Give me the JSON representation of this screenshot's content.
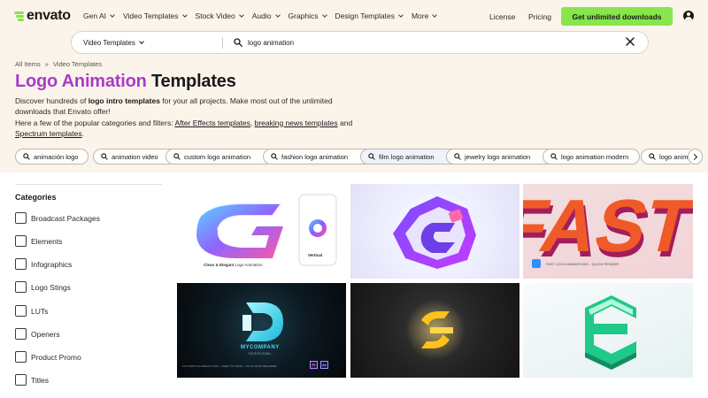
{
  "brand": {
    "name": "envato"
  },
  "nav": {
    "items": [
      {
        "label": "Gen AI"
      },
      {
        "label": "Video Templates"
      },
      {
        "label": "Stock Video"
      },
      {
        "label": "Audio"
      },
      {
        "label": "Graphics"
      },
      {
        "label": "Design Templates"
      },
      {
        "label": "More"
      }
    ],
    "license": "License",
    "pricing": "Pricing",
    "cta": "Get unlimited downloads"
  },
  "search": {
    "scope": "Video Templates",
    "query": "logo animation"
  },
  "breadcrumb": {
    "home": "All Items",
    "separator": "»",
    "current": "Video Templates"
  },
  "page": {
    "title_accent": "Logo Animation",
    "title_rest": " Templates",
    "desc": {
      "p1a": "Discover hundreds of ",
      "p1b": "logo intro templates",
      "p1c": " for your all projects. Make most out of the unlimited downloads that Envato offer!",
      "p2a": "Here a few of the popular categories and filters: ",
      "link1": "After Effects templates",
      "p2b": ", ",
      "link2": "breaking news templates",
      "p2c": " and ",
      "link3": "Spectrum templates",
      "p2d": "."
    }
  },
  "chips": [
    {
      "label": "animación logo"
    },
    {
      "label": "animation video"
    },
    {
      "label": "custom logo animation"
    },
    {
      "label": "fashion logo animation"
    },
    {
      "label": "film logo animation"
    },
    {
      "label": "jewelry logo animation"
    },
    {
      "label": "logo animation modern"
    },
    {
      "label": "logo anim"
    }
  ],
  "sidebar": {
    "title": "Categories",
    "categories": [
      {
        "label": "Broadcast Packages"
      },
      {
        "label": "Elements"
      },
      {
        "label": "Infographics"
      },
      {
        "label": "Logo Stings"
      },
      {
        "label": "LUTs"
      },
      {
        "label": "Openers"
      },
      {
        "label": "Product Promo"
      },
      {
        "label": "Titles"
      }
    ]
  },
  "thumbnails": {
    "t1": {
      "caption_a": "Clean & Elegant",
      "caption_b": " Logo Animation",
      "phone_label": "Vertical"
    },
    "t3": {
      "word": "FAST",
      "caption": "FAST LOGO ANIMATIONS · QUICK RENDER"
    },
    "t4": {
      "company": "MYCOMPANY",
      "tagline": "YOUR SLOGAN",
      "footer": "16:9 VERTICAL RESOLUTION  ·  VIDEO TUTORIAL  ·  NO PLUGINS REQUIRED",
      "badge1": "Pr",
      "badge2": "Ae"
    }
  },
  "colors": {
    "accent": "#a93bc9",
    "cta": "#87e64b",
    "hero_bg": "#fbf4ea"
  }
}
